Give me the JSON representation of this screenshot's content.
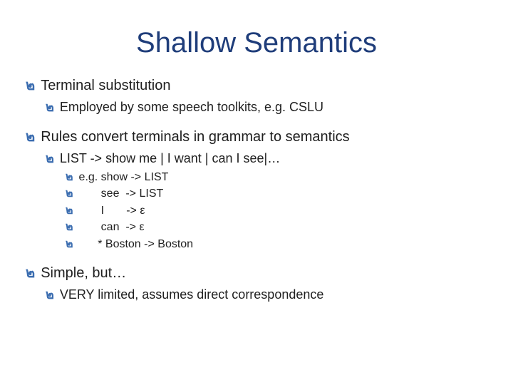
{
  "title": "Shallow Semantics",
  "bullet_glyph": "๒",
  "lines": [
    {
      "level": 1,
      "text": "Terminal substitution"
    },
    {
      "level": 2,
      "text": "Employed by some speech toolkits, e.g. CSLU"
    },
    {
      "level": 0,
      "text": ""
    },
    {
      "level": 1,
      "text": "Rules convert terminals in grammar to semantics"
    },
    {
      "level": 2,
      "text": "LIST -> show me | I want | can I see|…"
    },
    {
      "level": 3,
      "text": "e.g. show -> LIST",
      "mono": true
    },
    {
      "level": 3,
      "text": "       see  -> LIST",
      "mono": true
    },
    {
      "level": 3,
      "text": "       I       -> ε",
      "mono": true
    },
    {
      "level": 3,
      "text": "       can  -> ε",
      "mono": true
    },
    {
      "level": 3,
      "text": "      * Boston -> Boston",
      "mono": true
    },
    {
      "level": 0,
      "text": ""
    },
    {
      "level": 1,
      "text": "Simple, but…"
    },
    {
      "level": 2,
      "text": "VERY limited, assumes direct correspondence"
    }
  ]
}
